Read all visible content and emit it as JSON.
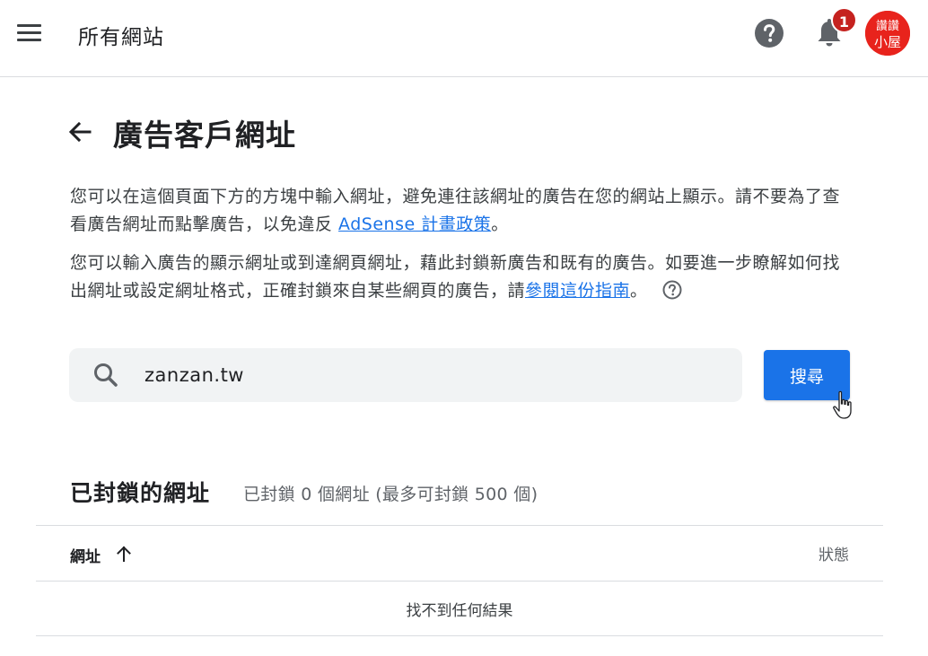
{
  "header": {
    "app_title": "所有網站",
    "notification_count": "1",
    "avatar_text_top": "讚讚",
    "avatar_text_bottom": "小屋"
  },
  "page": {
    "title": "廣告客戶網址"
  },
  "description": {
    "p1_text": "您可以在這個頁面下方的方塊中輸入網址，避免連往該網址的廣告在您的網站上顯示。請不要為了查看廣告網址而點擊廣告，以免違反 ",
    "p1_link": "AdSense 計畫政策",
    "p1_end": "。",
    "p2_text": "您可以輸入廣告的顯示網址或到達網頁網址，藉此封鎖新廣告和既有的廣告。如要進一步瞭解如何找出網址或設定網址格式，正確封鎖來自某些網頁的廣告，請",
    "p2_link": "參閱這份指南",
    "p2_end": "。"
  },
  "search": {
    "value": "zanzan.tw",
    "button_label": "搜尋"
  },
  "blocked": {
    "title": "已封鎖的網址",
    "summary": "已封鎖 0 個網址 (最多可封鎖 500 個)",
    "columns": {
      "url": "網址",
      "status": "狀態"
    },
    "empty_message": "找不到任何結果"
  },
  "colors": {
    "primary": "#1a73e8",
    "badge": "#c5221f",
    "avatar": "#e8231c"
  }
}
